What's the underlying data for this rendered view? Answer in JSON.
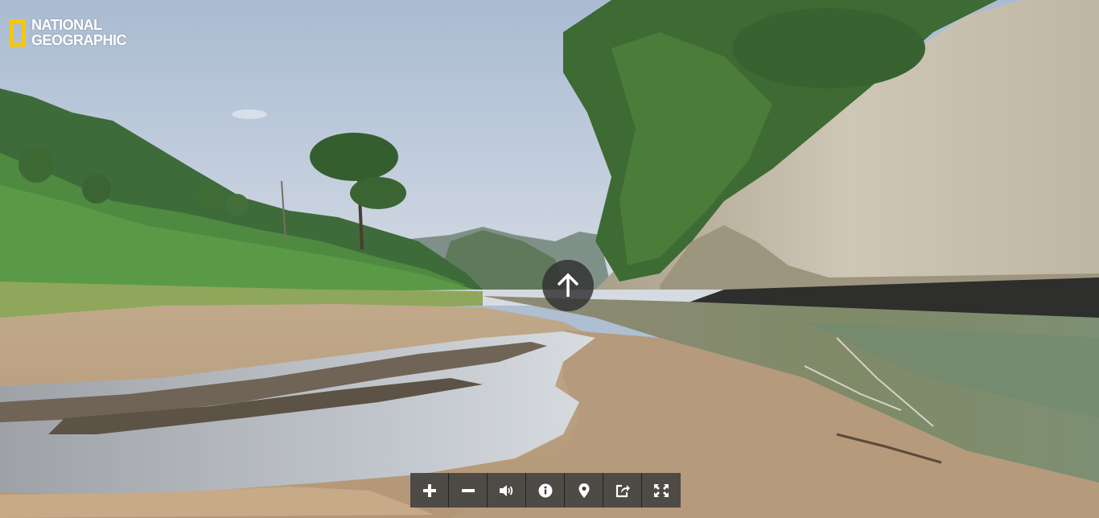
{
  "brand": {
    "line1": "NATIONAL",
    "line2": "GEOGRAPHIC",
    "frame_color": "#f7c800"
  },
  "navigation": {
    "forward_icon": "arrow-up-icon"
  },
  "toolbar": {
    "buttons": [
      {
        "icon": "plus-icon",
        "action": "zoom-in"
      },
      {
        "icon": "minus-icon",
        "action": "zoom-out"
      },
      {
        "icon": "volume-icon",
        "action": "sound"
      },
      {
        "icon": "info-icon",
        "action": "info"
      },
      {
        "icon": "map-pin-icon",
        "action": "location"
      },
      {
        "icon": "share-icon",
        "action": "share"
      },
      {
        "icon": "fullscreen-icon",
        "action": "fullscreen"
      }
    ]
  },
  "colors": {
    "sky": "#b9c8dc",
    "toolbar_bg": "#3c3c3c",
    "icon": "#ffffff"
  }
}
